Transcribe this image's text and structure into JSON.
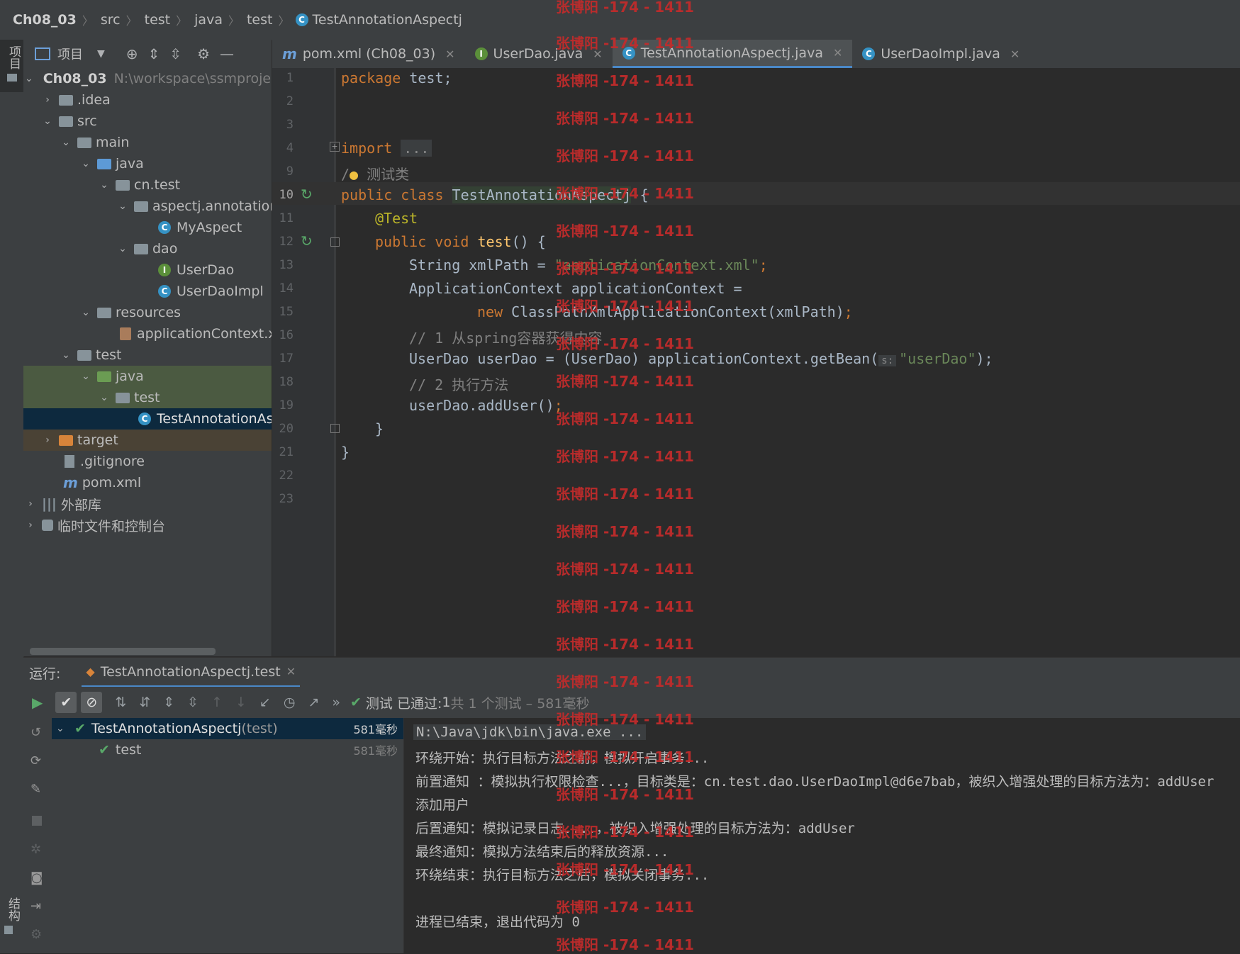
{
  "breadcrumb": [
    "Ch08_03",
    "src",
    "test",
    "java",
    "test",
    "TestAnnotationAspectj"
  ],
  "left_strip": {
    "top_label": "项目",
    "bottom_label": "结构"
  },
  "project_toolbar": {
    "label": "项目"
  },
  "tabs": [
    {
      "label": "pom.xml (Ch08_03)",
      "icon": "maven-icon"
    },
    {
      "label": "UserDao.java",
      "icon": "interface-icon"
    },
    {
      "label": "TestAnnotationAspectj.java",
      "icon": "class-icon"
    },
    {
      "label": "UserDaoImpl.java",
      "icon": "class-icon"
    }
  ],
  "tree": {
    "root": "Ch08_03",
    "root_path": "N:\\workspace\\ssmprojec",
    "idea": ".idea",
    "src": "src",
    "main": "main",
    "java": "java",
    "cn_test": "cn.test",
    "aspectj": "aspectj.annotation",
    "my_aspect": "MyAspect",
    "dao": "dao",
    "user_dao": "UserDao",
    "user_dao_impl": "UserDaoImpl",
    "resources": "resources",
    "app_ctx": "applicationContext.xm",
    "test": "test",
    "test_java": "java",
    "test_pkg": "test",
    "test_class": "TestAnnotationAsp",
    "target": "target",
    "gitignore": ".gitignore",
    "pom": "pom.xml",
    "ext_libs": "外部库",
    "scratches": "临时文件和控制台"
  },
  "editor": {
    "line_numbers": [
      "1",
      "2",
      "3",
      "4",
      "9",
      "10",
      "11",
      "12",
      "13",
      "14",
      "15",
      "16",
      "17",
      "18",
      "19",
      "20",
      "21",
      "22",
      "23"
    ],
    "line1_kw": "package",
    "line1_rest": " test;",
    "line4_kw": "import",
    "line4_fold": "...",
    "line9_cm_a": "/",
    "line9_cm_b": " 测试类",
    "line10_kw": "public class",
    "line10_cls": "TestAnnotationAspectj",
    "line10_brace": " {",
    "line11_ann": "@Test",
    "line12_kw": "public void",
    "line12_fn": "test",
    "line12_rest": "() {",
    "line13_a": "String xmlPath = ",
    "line13_str": "\"applicationContext.xml\"",
    "line13_end": ";",
    "line14": "ApplicationContext applicationContext =",
    "line15_kw": "new",
    "line15_rest": " ClassPathXmlApplicationContext(xmlPath)",
    "line15_end": ";",
    "line16": "// 1 从spring容器获得内容",
    "line17_a": "UserDao userDao = (UserDao) applicationContext.getBean(",
    "line17_hint": "s:",
    "line17_str": "\"userDao\"",
    "line17_end": ");",
    "line18": "// 2 执行方法",
    "line19": "userDao.addUser()",
    "line19_end": ";",
    "line20": "}",
    "line21": "}"
  },
  "run": {
    "label": "运行:",
    "tab": "TestAnnotationAspectj.test",
    "status_prefix": "测试 已通过: ",
    "status_count": "1",
    "status_rest": "共 1 个测试 – 581毫秒",
    "tree_root": "TestAnnotationAspectj",
    "tree_root_suffix": " (test)",
    "tree_root_time": "581毫秒",
    "tree_child": "test",
    "tree_child_time": "581毫秒"
  },
  "console": [
    "N:\\Java\\jdk\\bin\\java.exe ...",
    "环绕开始：执行目标方法之前，模拟开启事务...",
    "前置通知 ：模拟执行权限检查...，目标类是：cn.test.dao.UserDaoImpl@d6e7bab，被织入增强处理的目标方法为：addUser",
    "添加用户",
    "后置通知：模拟记录日志....，被织入增强处理的目标方法为：addUser",
    "最终通知：模拟方法结束后的释放资源...",
    "环绕结束：执行目标方法之后，模拟关闭事务...",
    "",
    "进程已结束，退出代码为 0"
  ],
  "watermark": "张博阳 -174 - 1411",
  "colors": {
    "accent": "#4a88c7",
    "keyword": "#cc7832",
    "string": "#6a8759",
    "annotation": "#bbb529",
    "pass": "#59a869",
    "watermark": "#c42b2b"
  }
}
